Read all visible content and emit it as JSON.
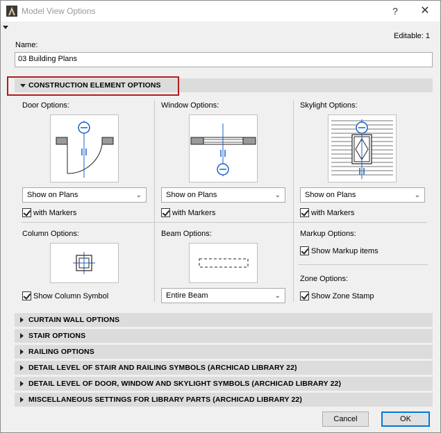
{
  "window": {
    "title": "Model View Options",
    "help_glyph": "?",
    "close_glyph": "✕"
  },
  "name": {
    "label": "Name:",
    "value": "03 Building Plans",
    "editable": "Editable: 1"
  },
  "construction": {
    "header": "CONSTRUCTION ELEMENT OPTIONS",
    "door": {
      "label": "Door Options:",
      "select": "Show on Plans",
      "markers": "with Markers"
    },
    "window": {
      "label": "Window Options:",
      "select": "Show on Plans",
      "markers": "with Markers"
    },
    "skylight": {
      "label": "Skylight Options:",
      "select": "Show on Plans",
      "markers": "with Markers"
    },
    "column": {
      "label": "Column Options:",
      "checkbox": "Show Column Symbol"
    },
    "beam": {
      "label": "Beam Options:",
      "select": "Entire Beam"
    },
    "markup": {
      "label": "Markup Options:",
      "checkbox": "Show Markup items"
    },
    "zone": {
      "label": "Zone Options:",
      "checkbox": "Show Zone Stamp"
    }
  },
  "sections": [
    {
      "label": "CURTAIN WALL OPTIONS"
    },
    {
      "label": "STAIR OPTIONS"
    },
    {
      "label": "RAILING OPTIONS"
    },
    {
      "label": "DETAIL LEVEL OF STAIR AND RAILING SYMBOLS (ARCHICAD LIBRARY 22)"
    },
    {
      "label": "DETAIL LEVEL OF DOOR, WINDOW AND SKYLIGHT SYMBOLS (ARCHICAD LIBRARY 22)"
    },
    {
      "label": "MISCELLANEOUS SETTINGS FOR LIBRARY PARTS (ARCHICAD LIBRARY 22)"
    }
  ],
  "buttons": {
    "cancel": "Cancel",
    "ok": "OK"
  },
  "colors": {
    "accent": "#0078d7",
    "highlight": "#b01c1c",
    "symbol": "#1a5fc8"
  }
}
